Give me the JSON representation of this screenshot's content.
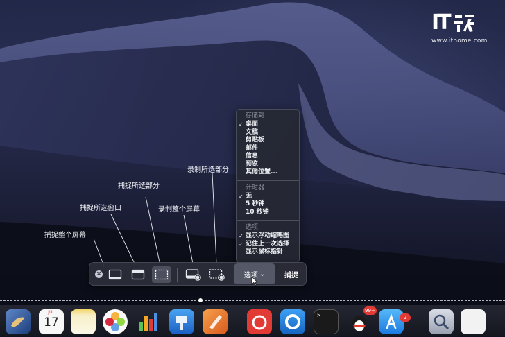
{
  "watermark": {
    "logo_mark": "IT",
    "logo_glyph": "之家",
    "url": "www.ithome.com"
  },
  "annotations": {
    "capture_entire_screen": "捕捉整个屏幕",
    "capture_selected_window": "捕捉所选窗口",
    "capture_selected_portion": "捕捉所选部分",
    "record_entire_screen": "录制整个屏幕",
    "record_selected_portion": "录制所选部分"
  },
  "options_menu": {
    "save_to": {
      "header": "存储到",
      "items": [
        {
          "label": "桌面",
          "checked": true
        },
        {
          "label": "文稿",
          "checked": false
        },
        {
          "label": "剪贴板",
          "checked": false
        },
        {
          "label": "邮件",
          "checked": false
        },
        {
          "label": "信息",
          "checked": false
        },
        {
          "label": "预览",
          "checked": false
        },
        {
          "label": "其他位置...",
          "checked": false
        }
      ]
    },
    "timer": {
      "header": "计时器",
      "items": [
        {
          "label": "无",
          "checked": true
        },
        {
          "label": "5 秒钟",
          "checked": false
        },
        {
          "label": "10 秒钟",
          "checked": false
        }
      ]
    },
    "options": {
      "header": "选项",
      "items": [
        {
          "label": "显示浮动缩略图",
          "checked": true
        },
        {
          "label": "记住上一次选择",
          "checked": true
        },
        {
          "label": "显示鼠标指针",
          "checked": false
        }
      ]
    },
    "check_glyph": "✓"
  },
  "toolbar": {
    "close_glyph": "×",
    "options_label": "选项",
    "options_chevron": "⌄",
    "capture_label": "捕捉"
  },
  "dock": {
    "calendar_month": "JUL",
    "calendar_day": "17",
    "appstore_badge": "2",
    "qq_badge": "99+",
    "terminal_prompt": ">_"
  },
  "colors": {
    "menu_bg": "#262834",
    "toolbar_bg": "#2c2e3a",
    "badge_red": "#e23b36",
    "text_light": "#eef0f4"
  }
}
